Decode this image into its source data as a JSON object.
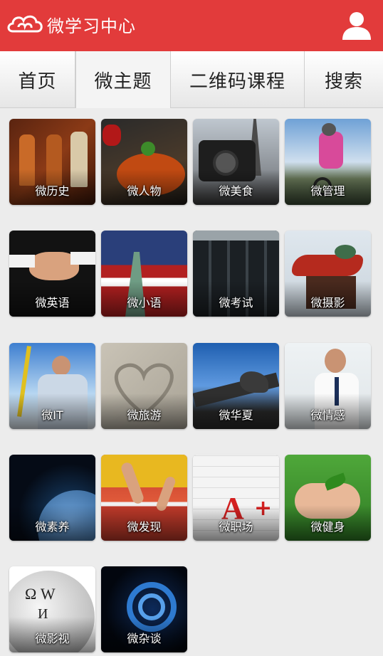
{
  "header": {
    "logo_text": "微学习中心",
    "brand_color": "#e23b3b",
    "logo_icon": "cloud-icon",
    "user_icon": "user-icon"
  },
  "tabs": [
    {
      "label": "首页",
      "active": false
    },
    {
      "label": "微主题",
      "active": true
    },
    {
      "label": "二维码课程",
      "active": false
    },
    {
      "label": "搜索",
      "active": false
    }
  ],
  "tiles": [
    {
      "label": "微历史"
    },
    {
      "label": "微人物"
    },
    {
      "label": "微美食"
    },
    {
      "label": "微管理"
    },
    {
      "label": "微英语"
    },
    {
      "label": "微小语"
    },
    {
      "label": "微考试"
    },
    {
      "label": "微摄影"
    },
    {
      "label": "微IT"
    },
    {
      "label": "微旅游"
    },
    {
      "label": "微华夏"
    },
    {
      "label": "微情感"
    },
    {
      "label": "微素养"
    },
    {
      "label": "微发现"
    },
    {
      "label": "微职场"
    },
    {
      "label": "微健身"
    },
    {
      "label": "微影视"
    },
    {
      "label": "微杂谈"
    }
  ]
}
